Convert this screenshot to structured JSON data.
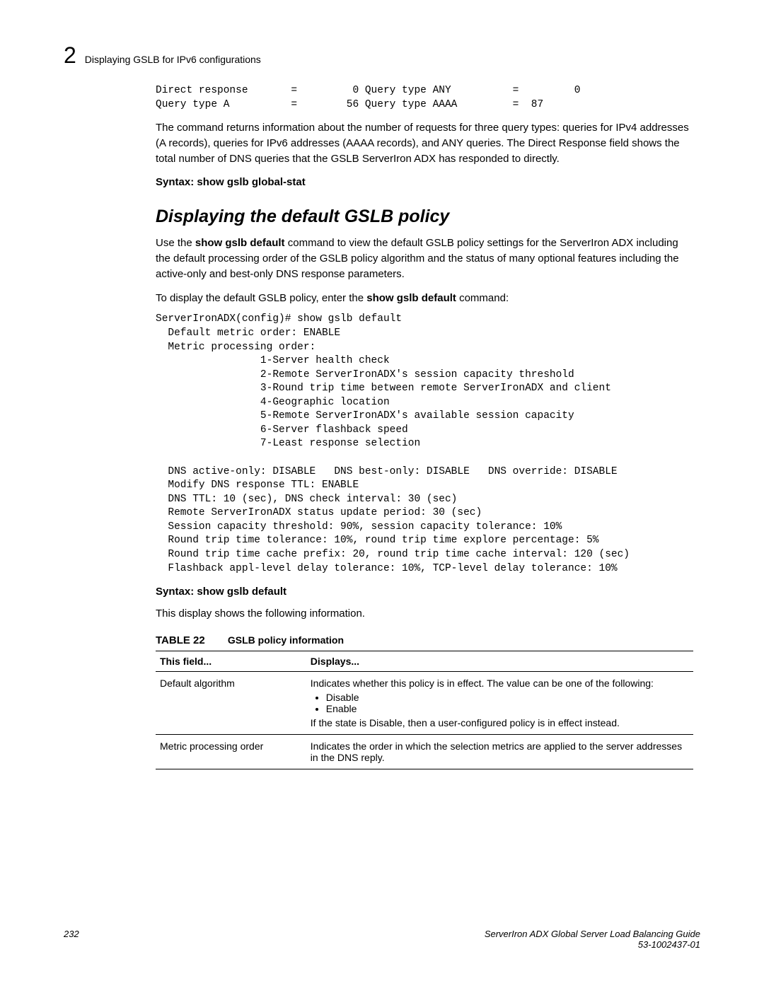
{
  "header": {
    "chapter_number": "2",
    "breadcrumb": "Displaying GSLB for IPv6 configurations"
  },
  "block1": {
    "code": "Direct response       =         0 Query type ANY          =         0\nQuery type A          =        56 Query type AAAA         =  87",
    "paragraph": "The command returns information about the number of requests for three query types: queries for IPv4 addresses (A records), queries for IPv6 addresses (AAAA records), and ANY queries. The Direct Response field shows the total number of DNS queries that the GSLB ServerIron ADX has responded to directly.",
    "syntax_label": "Syntax:",
    "syntax_cmd": "show gslb global-stat"
  },
  "section2": {
    "heading": "Displaying the default GSLB policy",
    "para1_a": "Use the ",
    "para1_cmd": "show gslb default",
    "para1_b": " command to view the default GSLB policy settings for the ServerIron ADX including the default processing order of the GSLB policy algorithm and the status of many optional features including the active-only and best-only DNS response parameters.",
    "para2_a": "To display the default GSLB policy, enter the ",
    "para2_cmd": "show gslb default",
    "para2_b": " command:",
    "code": "ServerIronADX(config)# show gslb default\n  Default metric order: ENABLE\n  Metric processing order:\n                 1-Server health check\n                 2-Remote ServerIronADX's session capacity threshold\n                 3-Round trip time between remote ServerIronADX and client\n                 4-Geographic location\n                 5-Remote ServerIronADX's available session capacity\n                 6-Server flashback speed\n                 7-Least response selection\n\n  DNS active-only: DISABLE   DNS best-only: DISABLE   DNS override: DISABLE\n  Modify DNS response TTL: ENABLE\n  DNS TTL: 10 (sec), DNS check interval: 30 (sec)\n  Remote ServerIronADX status update period: 30 (sec)\n  Session capacity threshold: 90%, session capacity tolerance: 10%\n  Round trip time tolerance: 10%, round trip time explore percentage: 5%\n  Round trip time cache prefix: 20, round trip time cache interval: 120 (sec)\n  Flashback appl-level delay tolerance: 10%, TCP-level delay tolerance: 10%",
    "syntax_label": "Syntax:",
    "syntax_cmd": "show gslb default",
    "para3": "This display shows the following information."
  },
  "table": {
    "number": "TABLE 22",
    "title": "GSLB policy information",
    "headers": {
      "col1": "This field...",
      "col2": "Displays..."
    },
    "rows": [
      {
        "field": "Default algorithm",
        "desc_a": "Indicates whether this policy is in effect. The value can be one of the following:",
        "bullets": [
          "Disable",
          "Enable"
        ],
        "desc_b": "If the state is Disable, then a user-configured policy is in effect instead."
      },
      {
        "field": "Metric processing order",
        "desc_a": "Indicates the order in which the selection metrics are applied to the server addresses in the DNS reply.",
        "bullets": [],
        "desc_b": ""
      }
    ]
  },
  "footer": {
    "page": "232",
    "title": "ServerIron ADX Global Server Load Balancing Guide",
    "docnum": "53-1002437-01"
  }
}
